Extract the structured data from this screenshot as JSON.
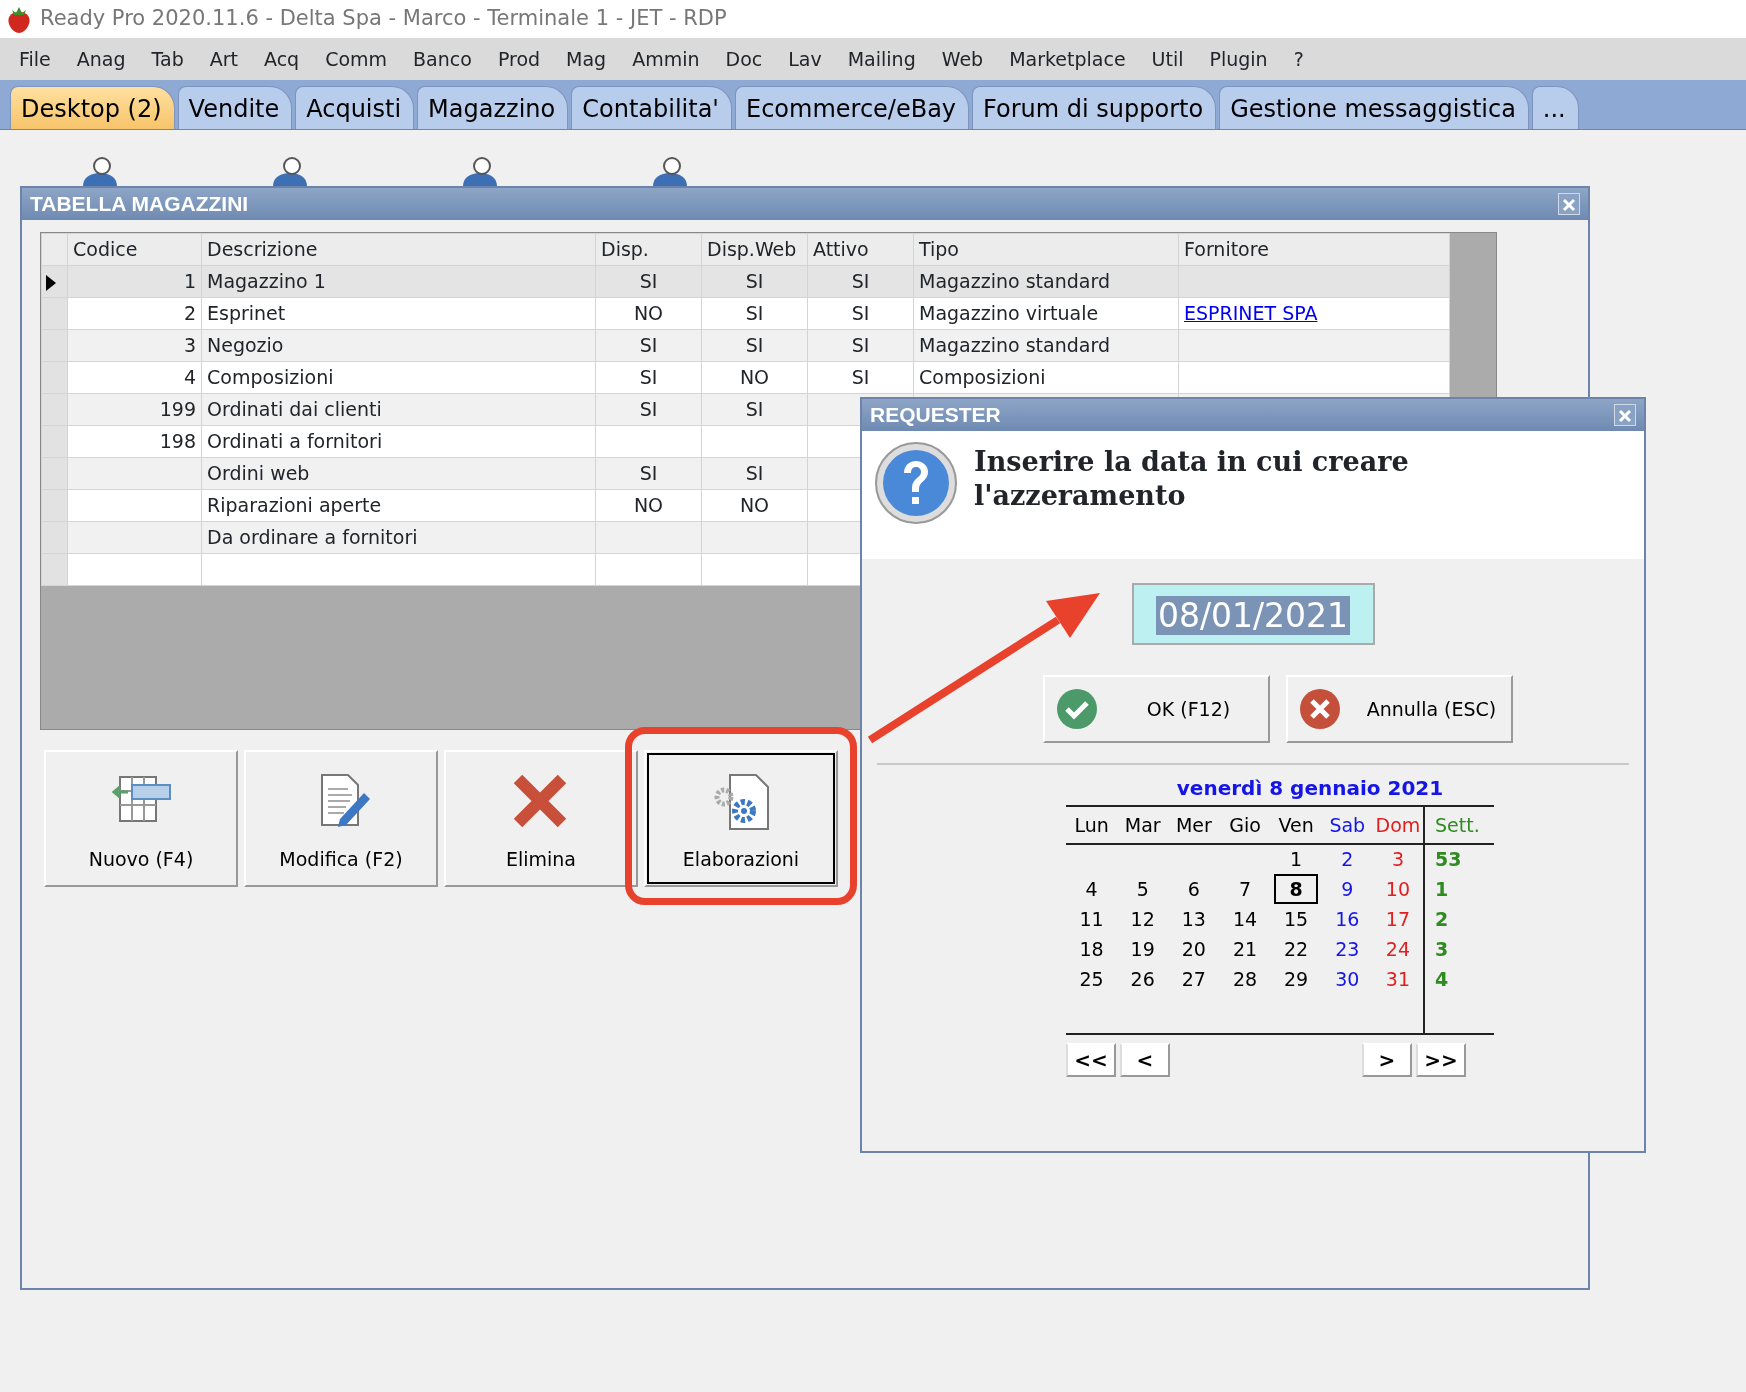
{
  "window": {
    "title": "Ready Pro 2020.11.6 - Delta Spa - Marco - Terminale 1 - JET - RDP"
  },
  "menu": [
    "File",
    "Anag",
    "Tab",
    "Art",
    "Acq",
    "Comm",
    "Banco",
    "Prod",
    "Mag",
    "Ammin",
    "Doc",
    "Lav",
    "Mailing",
    "Web",
    "Marketplace",
    "Util",
    "Plugin",
    "?"
  ],
  "tabs": [
    {
      "label": "Desktop (2)",
      "selected": true
    },
    {
      "label": "Vendite",
      "selected": false
    },
    {
      "label": "Acquisti",
      "selected": false
    },
    {
      "label": "Magazzino",
      "selected": false
    },
    {
      "label": "Contabilita'",
      "selected": false
    },
    {
      "label": "Ecommerce/eBay",
      "selected": false
    },
    {
      "label": "Forum di supporto",
      "selected": false
    },
    {
      "label": "Gestione messaggistica",
      "selected": false
    },
    {
      "label": "...",
      "selected": false
    }
  ],
  "table_window": {
    "title": "TABELLA MAGAZZINI",
    "columns": [
      {
        "label": "Codice",
        "kind": "number"
      },
      {
        "label": "Descrizione",
        "kind": "text"
      },
      {
        "label": "Disp.",
        "kind": "flag"
      },
      {
        "label": "Disp.Web",
        "kind": "flag"
      },
      {
        "label": "Attivo",
        "kind": "flag"
      },
      {
        "label": "Tipo",
        "kind": "text"
      },
      {
        "label": "Fornitore",
        "kind": "link"
      }
    ],
    "rows": [
      {
        "current": true,
        "cells": [
          "1",
          "Magazzino 1",
          "SI",
          "SI",
          "SI",
          "Magazzino standard",
          null
        ]
      },
      {
        "current": false,
        "cells": [
          "2",
          "Esprinet",
          "NO",
          "SI",
          "SI",
          "Magazzino virtuale",
          "ESPRINET SPA"
        ]
      },
      {
        "current": false,
        "cells": [
          "3",
          "Negozio",
          "SI",
          "SI",
          "SI",
          "Magazzino standard",
          null
        ]
      },
      {
        "current": false,
        "cells": [
          "4",
          "Composizioni",
          "SI",
          "NO",
          "SI",
          "Composizioni",
          null
        ]
      },
      {
        "current": false,
        "cells": [
          "199",
          "Ordinati dai clienti",
          "SI",
          "SI",
          null,
          null,
          null
        ]
      },
      {
        "current": false,
        "cells": [
          "198",
          "Ordinati a fornitori",
          null,
          null,
          null,
          null,
          null
        ]
      },
      {
        "current": false,
        "cells": [
          null,
          "Ordini web",
          "SI",
          "SI",
          null,
          null,
          null
        ]
      },
      {
        "current": false,
        "cells": [
          null,
          "Riparazioni aperte",
          "NO",
          "NO",
          null,
          null,
          null
        ]
      },
      {
        "current": false,
        "cells": [
          null,
          "Da ordinare a fornitori",
          null,
          null,
          null,
          null,
          null
        ]
      }
    ],
    "buttons": [
      {
        "label": "Nuovo (F4)",
        "kind": "new",
        "focused": false
      },
      {
        "label": "Modifica (F2)",
        "kind": "edit",
        "focused": false
      },
      {
        "label": "Elimina",
        "kind": "delete",
        "focused": false
      },
      {
        "label": "Elaborazioni",
        "kind": "process",
        "focused": true
      }
    ]
  },
  "requester": {
    "title": "REQUESTER",
    "message": "Inserire la data in cui creare l'azzeramento",
    "date_value": "08/01/2021",
    "buttons": [
      {
        "label": "OK (F12)",
        "kind": "ok"
      },
      {
        "label": "Annulla (ESC)",
        "kind": "cancel"
      }
    ],
    "calendar": {
      "heading": "venerdì 8 gennaio 2021",
      "weekdays": [
        {
          "label": "Lun",
          "kind": "weekday"
        },
        {
          "label": "Mar",
          "kind": "weekday"
        },
        {
          "label": "Mer",
          "kind": "weekday"
        },
        {
          "label": "Gio",
          "kind": "weekday"
        },
        {
          "label": "Ven",
          "kind": "weekday"
        },
        {
          "label": "Sab",
          "kind": "saturday"
        },
        {
          "label": "Dom",
          "kind": "sunday"
        }
      ],
      "week_header": "Sett.",
      "weeks": [
        {
          "number": "53",
          "days": [
            {
              "day": "1",
              "selected": false
            },
            {
              "day": "2",
              "selected": false
            },
            {
              "day": "3",
              "selected": false
            }
          ]
        },
        {
          "number": "1",
          "days": [
            {
              "day": "4",
              "selected": false
            },
            {
              "day": "5",
              "selected": false
            },
            {
              "day": "6",
              "selected": false
            },
            {
              "day": "7",
              "selected": false
            },
            {
              "day": "8",
              "selected": true
            },
            {
              "day": "9",
              "selected": false
            },
            {
              "day": "10",
              "selected": false
            }
          ]
        },
        {
          "number": "2",
          "days": [
            {
              "day": "11",
              "selected": false
            },
            {
              "day": "12",
              "selected": false
            },
            {
              "day": "13",
              "selected": false
            },
            {
              "day": "14",
              "selected": false
            },
            {
              "day": "15",
              "selected": false
            },
            {
              "day": "16",
              "selected": false
            },
            {
              "day": "17",
              "selected": false
            }
          ]
        },
        {
          "number": "3",
          "days": [
            {
              "day": "18",
              "selected": false
            },
            {
              "day": "19",
              "selected": false
            },
            {
              "day": "20",
              "selected": false
            },
            {
              "day": "21",
              "selected": false
            },
            {
              "day": "22",
              "selected": false
            },
            {
              "day": "23",
              "selected": false
            },
            {
              "day": "24",
              "selected": false
            }
          ]
        },
        {
          "number": "4",
          "days": [
            {
              "day": "25",
              "selected": false
            },
            {
              "day": "26",
              "selected": false
            },
            {
              "day": "27",
              "selected": false
            },
            {
              "day": "28",
              "selected": false
            },
            {
              "day": "29",
              "selected": false
            },
            {
              "day": "30",
              "selected": false
            },
            {
              "day": "31",
              "selected": false
            }
          ]
        }
      ],
      "nav_buttons": [
        "<<",
        "<",
        ">",
        ">>"
      ]
    }
  },
  "annotations": [
    {
      "kind": "arrow"
    }
  ]
}
